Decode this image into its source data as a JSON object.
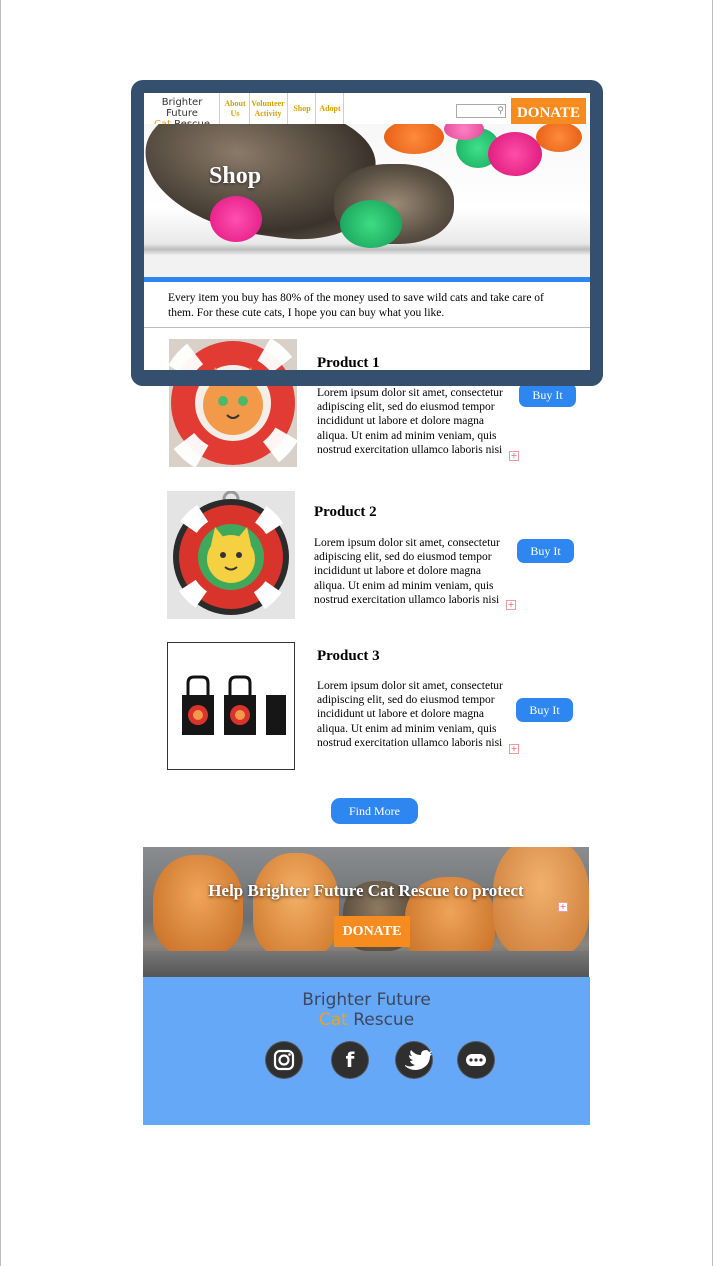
{
  "brand": {
    "line1": "Brighter Future",
    "cat": "Cat",
    "rescue": "Rescue"
  },
  "nav": {
    "links": [
      {
        "label": "About Us"
      },
      {
        "label": "Volunteer Activity"
      },
      {
        "label": "Shop"
      },
      {
        "label": "Adopt"
      }
    ],
    "search_placeholder": "",
    "donate_label": "DONATE"
  },
  "hero": {
    "title": "Shop"
  },
  "intro": {
    "text": "Every item you buy has 80% of the money used to save wild cats and take care of them. For these cute cats, I hope you can buy what you like."
  },
  "products": [
    {
      "title": "Product 1",
      "description": "Lorem ipsum dolor sit amet, consectetur adipiscing elit, sed do eiusmod tempor incididunt ut labore et dolore magna aliqua. Ut enim ad minim veniam, quis nostrud exercitation ullamco laboris nisi",
      "button": "Buy It"
    },
    {
      "title": "Product 2",
      "description": "Lorem ipsum dolor sit amet, consectetur adipiscing elit, sed do eiusmod tempor incididunt ut labore et dolore magna aliqua. Ut enim ad minim veniam, quis nostrud exercitation ullamco laboris nisi",
      "button": "Buy It"
    },
    {
      "title": "Product 3",
      "description": "Lorem ipsum dolor sit amet, consectetur adipiscing elit, sed do eiusmod tempor incididunt ut labore et dolore magna aliqua. Ut enim ad minim veniam, quis nostrud exercitation ullamco laboris nisi",
      "button": "Buy It"
    }
  ],
  "find_more": "Find More",
  "banner": {
    "title": "Help Brighter Future Cat Rescue to protect",
    "donate_label": "DONATE"
  },
  "footer": {
    "brand_line1": "Brighter Future",
    "brand_cat": "Cat",
    "brand_rescue": "Rescue",
    "social": [
      {
        "icon": "instagram-icon"
      },
      {
        "icon": "facebook-icon"
      },
      {
        "icon": "twitter-icon"
      },
      {
        "icon": "more-icon"
      }
    ]
  },
  "colors": {
    "accent_blue": "#2e86f0",
    "donate_orange": "#f68b1f",
    "frame": "#34506e",
    "footer_bg": "#65a8f7",
    "logo_cat": "#f0a020"
  }
}
